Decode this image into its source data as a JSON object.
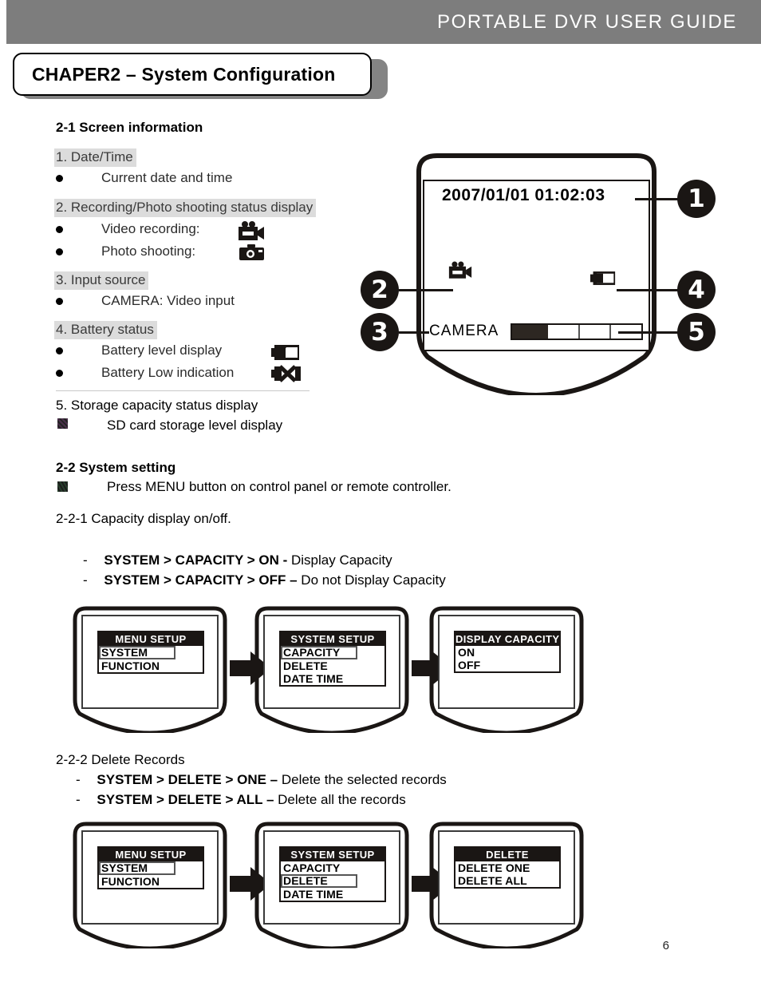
{
  "header": {
    "title": "PORTABLE DVR USER GUIDE",
    "band_color": "#7d7d7d"
  },
  "chapter": {
    "title": "CHAPER2 – System Configuration"
  },
  "section_2_1": {
    "heading": "2-1 Screen information",
    "items": [
      {
        "number_heading": "1. Date/Time",
        "bullets": [
          {
            "text": "Current date and time",
            "icon": null
          }
        ]
      },
      {
        "number_heading": "2. Recording/Photo shooting status display",
        "bullets": [
          {
            "text": "Video recording:",
            "icon": "camcorder-icon"
          },
          {
            "text": "Photo shooting:",
            "icon": "photo-camera-icon"
          }
        ]
      },
      {
        "number_heading": "3. Input source",
        "bullets": [
          {
            "text": "CAMERA: Video input",
            "icon": null
          }
        ]
      },
      {
        "number_heading": "4. Battery status",
        "bullets": [
          {
            "text": "Battery level display",
            "icon": "battery-level-icon"
          },
          {
            "text": "Battery Low indication",
            "icon": "battery-low-icon"
          }
        ]
      }
    ],
    "item5_heading": "5. Storage capacity status display",
    "item5_bullet": "SD card storage level display"
  },
  "dvr_screen": {
    "datetime": "2007/01/01  01:02:03",
    "input_label": "CAMERA",
    "recording_icon": "camcorder-icon",
    "battery_icon": "battery-level-icon",
    "capacity_fill_percent": 28,
    "callouts": [
      {
        "number": "1",
        "target": "datetime"
      },
      {
        "number": "2",
        "target": "recording-status"
      },
      {
        "number": "3",
        "target": "input-source"
      },
      {
        "number": "4",
        "target": "battery-status"
      },
      {
        "number": "5",
        "target": "storage-capacity"
      }
    ]
  },
  "section_2_2": {
    "heading": "2-2 System setting",
    "instruction": "Press MENU button on control panel or remote controller.",
    "sub_2_2_1": {
      "heading": "2-2-1 Capacity display on/off.",
      "paths": [
        {
          "dash": "-",
          "bold": "SYSTEM > CAPACITY > ON -",
          "rest": " Display Capacity"
        },
        {
          "dash": "-",
          "bold": "SYSTEM > CAPACITY > OFF –",
          "rest": " Do not Display Capacity"
        }
      ],
      "flow": [
        {
          "name": "menu-setup-screen",
          "title": "MENU SETUP",
          "items": [
            {
              "label": "SYSTEM",
              "selected": true
            },
            {
              "label": "FUNCTION",
              "selected": false
            }
          ]
        },
        {
          "name": "system-setup-screen",
          "title": "SYSTEM SETUP",
          "items": [
            {
              "label": "CAPACITY",
              "selected": true
            },
            {
              "label": "DELETE",
              "selected": false
            },
            {
              "label": "DATE TIME",
              "selected": false
            }
          ]
        },
        {
          "name": "display-capacity-screen",
          "title": "DISPLAY CAPACITY",
          "items": [
            {
              "label": "ON",
              "selected": false
            },
            {
              "label": "OFF",
              "selected": false
            }
          ]
        }
      ]
    },
    "sub_2_2_2": {
      "heading": "2-2-2 Delete Records",
      "paths": [
        {
          "dash": "-",
          "bold": "SYSTEM > DELETE > ONE –",
          "rest": " Delete the selected records"
        },
        {
          "dash": "-",
          "bold": "SYSTEM > DELETE > ALL –",
          "rest": " Delete all the records"
        }
      ],
      "flow": [
        {
          "name": "menu-setup-screen",
          "title": "MENU SETUP",
          "items": [
            {
              "label": "SYSTEM",
              "selected": true
            },
            {
              "label": "FUNCTION",
              "selected": false
            }
          ]
        },
        {
          "name": "system-setup-screen",
          "title": "SYSTEM SETUP",
          "items": [
            {
              "label": "CAPACITY",
              "selected": false
            },
            {
              "label": "DELETE",
              "selected": true
            },
            {
              "label": "DATE TIME",
              "selected": false
            }
          ]
        },
        {
          "name": "delete-screen",
          "title": "DELETE",
          "items": [
            {
              "label": "DELETE ONE",
              "selected": false
            },
            {
              "label": "DELETE ALL",
              "selected": false
            }
          ]
        }
      ]
    }
  },
  "footer": {
    "page_number": "6"
  }
}
